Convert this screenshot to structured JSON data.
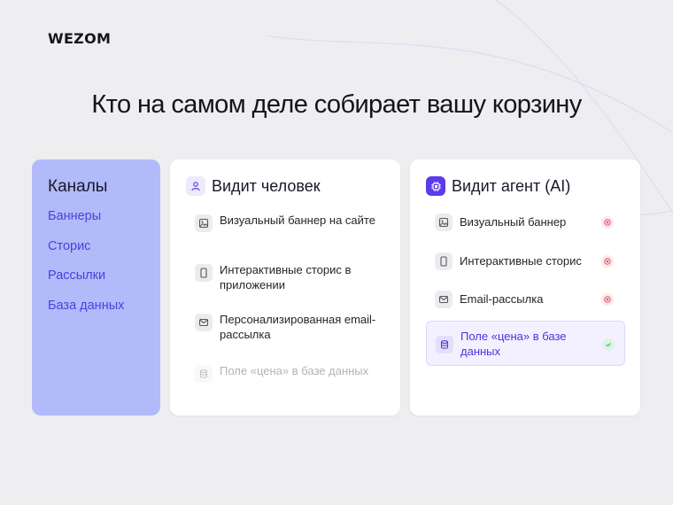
{
  "brand": {
    "logo": "WEZOM"
  },
  "headline": "Кто на самом деле собирает вашу корзину",
  "channels": {
    "title": "Каналы",
    "items": [
      "Баннеры",
      "Сторис",
      "Рассылки",
      "База данных"
    ]
  },
  "human": {
    "title": "Видит человек",
    "icon": "user-icon",
    "items": [
      {
        "text": "Визуальный баннер на сайте",
        "icon": "image-icon"
      },
      {
        "text": "Интерактивные сторис в приложении",
        "icon": "phone-icon"
      },
      {
        "text": "Персонализированная email-рассылка",
        "icon": "mail-icon"
      },
      {
        "text": "Поле «цена» в базе данных",
        "icon": "database-icon",
        "faded": true
      }
    ]
  },
  "agent": {
    "title": "Видит агент (AI)",
    "icon": "chip-icon",
    "items": [
      {
        "text": "Визуальный баннер",
        "icon": "image-icon",
        "status": "not-seen"
      },
      {
        "text": "Интерактивные сторис",
        "icon": "phone-icon",
        "status": "not-seen"
      },
      {
        "text": "Email-рассылка",
        "icon": "mail-icon",
        "status": "not-seen"
      },
      {
        "text": "Поле «цена» в базе данных",
        "icon": "database-icon",
        "status": "seen"
      }
    ]
  },
  "colors": {
    "accent": "#5b3bea",
    "channels_bg": "#b2bbf9",
    "link": "#4a3fe0",
    "no": "#e0475a",
    "yes": "#3fae6a"
  }
}
